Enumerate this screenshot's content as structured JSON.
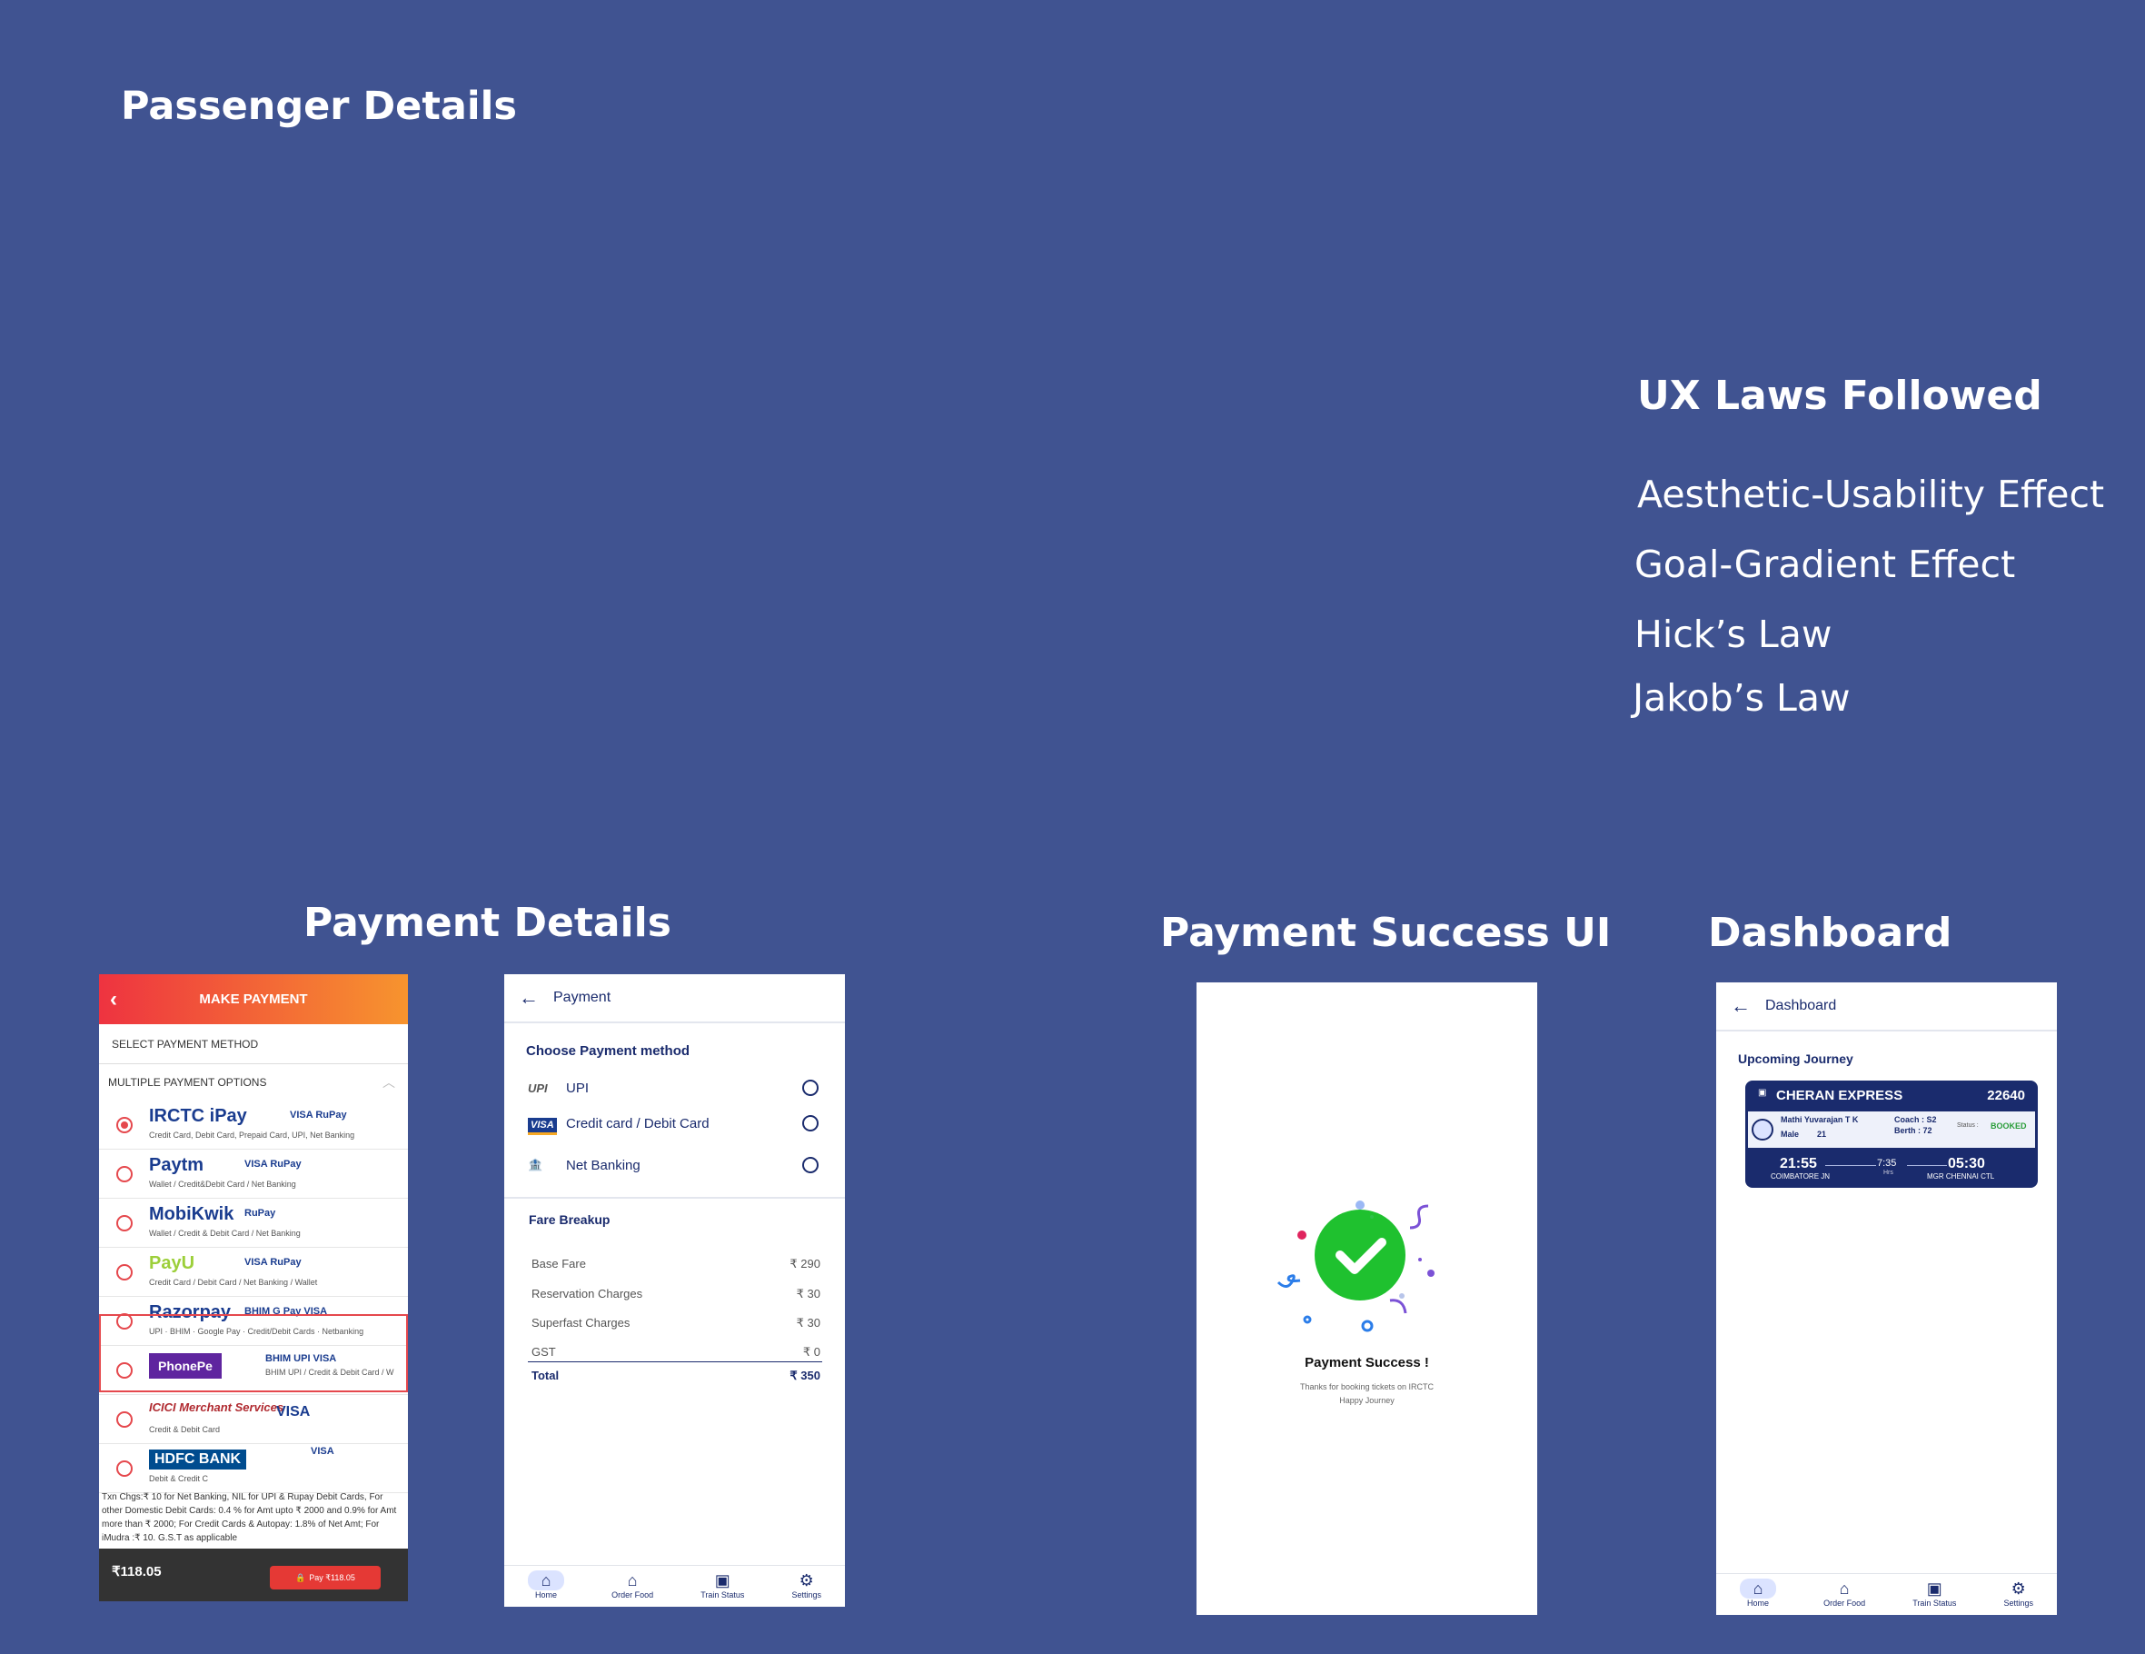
{
  "headings": {
    "passenger_details": "Passenger Details",
    "payment_details": "Payment Details",
    "payment_success_ui": "Payment Success UI",
    "dashboard": "Dashboard",
    "ux_laws": "UX Laws Followed"
  },
  "ux_laws": [
    "Aesthetic-Usability Effect",
    "Goal-Gradient Effect",
    "Hick’s Law",
    "Jakob’s Law"
  ],
  "old_payment": {
    "header": "MAKE PAYMENT",
    "select_method": "SELECT PAYMENT METHOD",
    "multiple_options": "MULTIPLE PAYMENT OPTIONS",
    "options": [
      {
        "brand": "IRCTC iPay",
        "sub": "Credit Card, Debit Card, Prepaid Card, UPI, Net Banking",
        "cards": "VISA  RuPay",
        "selected": true,
        "color": "#1a3c8f"
      },
      {
        "brand": "Paytm",
        "sub": "Wallet / Credit&Debit Card / Net Banking",
        "cards": "VISA  RuPay",
        "selected": false,
        "color": "#1a3c8f"
      },
      {
        "brand": "MobiKwik",
        "sub": "Wallet / Credit & Debit Card / Net Banking",
        "cards": "RuPay",
        "selected": false,
        "color": "#1a3c8f"
      },
      {
        "brand": "PayU",
        "sub": "Credit Card / Debit Card / Net Banking / Wallet",
        "cards": "VISA  RuPay",
        "selected": false,
        "color": "#9ccf3a"
      },
      {
        "brand": "Razorpay",
        "sub": "UPI · BHIM · Google Pay · Credit/Debit Cards · Netbanking",
        "cards": "BHIM  G Pay  VISA",
        "selected": false,
        "color": "#1a3c8f"
      },
      {
        "brand": "PhonePe",
        "sub": "BHIM UPI / Credit & Debit Card / W",
        "cards": "BHIM UPI  VISA",
        "selected": false,
        "color": "#5f259f"
      },
      {
        "brand": "ICICI Merchant Services",
        "sub": "Credit & Debit Card",
        "cards": "VISA",
        "selected": false,
        "color": "#b02a30"
      },
      {
        "brand": "HDFC BANK",
        "sub": "Debit & Credit C",
        "cards": "VISA",
        "selected": false,
        "color": "#004c8f"
      }
    ],
    "note": "Txn Chgs:₹ 10 for Net Banking, NIL for UPI & Rupay Debit Cards, For other Domestic Debit Cards: 0.4 % for Amt upto ₹ 2000 and 0.9% for Amt more than ₹ 2000; For Credit Cards & Autopay: 1.8% of Net Amt; For iMudra :₹ 10. G.S.T as applicable",
    "amount": "₹118.05",
    "pay_button": "Pay ₹118.05"
  },
  "new_payment": {
    "title": "Payment",
    "choose_method": "Choose Payment method",
    "methods": [
      {
        "logo": "UPI",
        "label": "UPI"
      },
      {
        "logo": "VISA",
        "label": "Credit card / Debit Card"
      },
      {
        "logo": "🏦",
        "label": "Net Banking"
      }
    ],
    "fare_title": "Fare Breakup",
    "fares": [
      {
        "label": "Base Fare",
        "value": "₹ 290"
      },
      {
        "label": "Reservation Charges",
        "value": "₹ 30"
      },
      {
        "label": "Superfast Charges",
        "value": "₹ 30"
      },
      {
        "label": "GST",
        "value": "₹ 0"
      }
    ],
    "total_label": "Total",
    "total_value": "₹ 350"
  },
  "nav": [
    "Home",
    "Order Food",
    "Train Status",
    "Settings"
  ],
  "success": {
    "title": "Payment Success !",
    "line1": "Thanks for booking tickets on IRCTC",
    "line2": "Happy Journey",
    "check_color": "#1fc12f"
  },
  "dashboard": {
    "title": "Dashboard",
    "upcoming": "Upcoming Journey",
    "train_name": "CHERAN EXPRESS",
    "train_no": "22640",
    "passenger": "Mathi Yuvarajan T K",
    "gender": "Male",
    "age": "21",
    "coach": "Coach : S2",
    "berth": "Berth : 72",
    "status_label": "Status :",
    "status": "BOOKED",
    "dep_time": "21:55",
    "dep_station": "COIMBATORE JN",
    "duration": "7:35",
    "duration_unit": "Hrs",
    "arr_time": "05:30",
    "arr_station": "MGR CHENNAI CTL"
  }
}
